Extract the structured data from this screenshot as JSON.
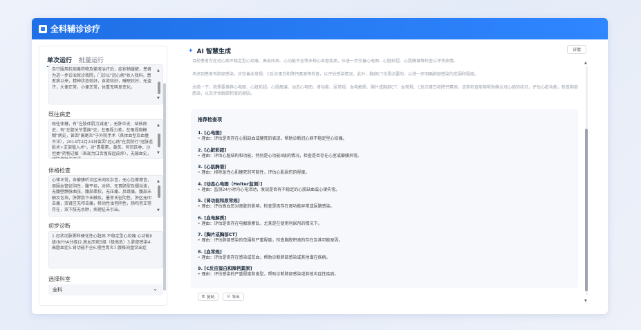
{
  "app": {
    "title": "全科辅诊诊疗"
  },
  "left": {
    "tabs": [
      "单次运行",
      "批量运行"
    ],
    "history_text": "自行服用抗病毒药物及输液治疗后，症状稍缓解，患者为进一步诊治就诊我院，门诊以\"冠心病\"收入我科。患者病以来，精神状态较好，食欲较好，睡眠较好，无盗汗，大便正常，小便正常，体重无明显变化。",
    "past_title": "既往病史",
    "past_text": "既往体健，有\"左肢体肌力减退\"，无肝炎史、结核病史，有\"左膝关节置换\"史，左眼视力差，左眼视物模糊\"病史，曾因\"阑尾炎\"于外院手术（具体血型及血量不详），2014年4月24日曾因\"冠心病\"在我院行\"冠脉造影术+支架植入术\"。对\"青霉素、黄芪、阿司匹林、沙坦类\"药物过敏（表现为口舌瘙痒起皮疹），无输血史，预防接种史不详。",
    "exam_title": "体格检查",
    "exam_text": "心律正常，各瓣膜听诊区未闻及杂音，无心包摩擦音，周围血管征阴性，腹平坦，对称，无胃肠型及蠕动波，无腹壁静脉曲张，腹部柔软，无压痛、反跳痛，腹部未触及包块，肝脾肋下未触及，墨菲氏征阴性，肝区无叩击痛，双肾区无叩击痛，移动性浊音阴性，肠鸣音正常存在，双下肢无水肿，病理征未引出。",
    "diag_title": "初步诊断",
    "diag_text": "1.冠状动脉粥样硬化性心脏病 不稳定型心绞痛 心功能II级(NYHA分级)2.高血压病3级（极高危）3.肺部感染4.高脂血症5.肾功能不全6.慢性胃炎7.腰椎间盘突出症",
    "dept_title": "选择科室",
    "dept_value": "全科"
  },
  "right": {
    "header": "AI 智慧生成",
    "detail_label": "详情",
    "para1": "目前患者存在冠心病不稳定型心绞痛、高血压病、心功能不全等多种心血管疾病，应进一步完善心电图、心脏彩超、心肌酶谱等检查以评估病情。",
    "para2": "考虑到患者有肺部感染，应完善血常规、C反应蛋白和降钙素原等检查，以评估感染情况。此外，胸部CT也是必要的，以进一步明确肺部感染的范围和程度。",
    "para3": "总结一下，我需要推荐心电图、心脏彩超、心肌酶谱、动态心电图、肾功能、尿常规、血电解质、胸片或胸部CT、血常规、C反应蛋白和降钙素原。这些检查能够帮助确认冠心病的状况，评估心脏功能，检查肺部感染，以及评估胸部积液的原因。",
    "card_title": "推荐检查项",
    "items": [
      {
        "title": "1. [心电图]",
        "reason": "• 理由：评估是否存在心肌缺血或梗死的表现，帮助诊断冠心病不稳定型心绞痛。"
      },
      {
        "title": "2. [心脏彩超]",
        "reason": "• 理由：评估心脏结构和功能，特别是心功能II级的情况，检查是否存在心室或瓣膜异常。"
      },
      {
        "title": "3. [心肌酶谱]",
        "reason": "• 理由：排除急性心肌梗死的可能性，评估心肌损伤的程度。"
      },
      {
        "title": "4. [动态心电图（Holter监测）]",
        "reason": "• 理由：监测24小时内心电活动，发现是否有不稳定的心肌缺血或心律失常。"
      },
      {
        "title": "5. [肾功能和尿常规]",
        "reason": "• 理由：评估高血压对肾脏的影响，检查是否存在肾功能异常或尿路感染。"
      },
      {
        "title": "6. [血电解质]",
        "reason": "• 理由：评估是否存在电解质紊乱，尤其是在使用利尿剂的情况下。"
      },
      {
        "title": "7. [胸片或胸部CT]",
        "reason": "• 理由：评估肺部感染的范围和严重程度，检查胸腔积液的存在及其可能原因。"
      },
      {
        "title": "8. [血常规]",
        "reason": "• 理由：评估是否存在感染或贫血，帮助诊断肺部感染或其他潜在疾病。"
      },
      {
        "title": "9. [C反应蛋白和降钙素原]",
        "reason": "• 理由：评估感染的严重程度和类型，帮助诊断肺部感染或其他炎症性疾病。"
      }
    ],
    "copy_label": "复制",
    "export_label": "导出"
  }
}
